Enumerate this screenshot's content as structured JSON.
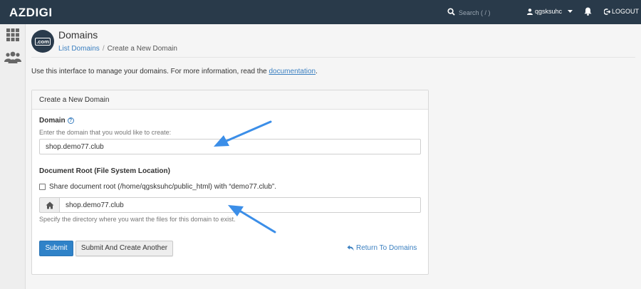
{
  "topbar": {
    "logo": "AZDIGI",
    "search_placeholder": "Search ( / )",
    "username": "qgsksuhc",
    "logout_label": "LOGOUT"
  },
  "header": {
    "logo_text": ".com",
    "title": "Domains",
    "breadcrumb_link": "List Domains",
    "breadcrumb_current": "Create a New Domain"
  },
  "intro": {
    "text": "Use this interface to manage your domains. For more information, read the ",
    "link": "documentation",
    "suffix": "."
  },
  "form": {
    "panel_title": "Create a New Domain",
    "domain_label": "Domain",
    "domain_hint": "Enter the domain that you would like to create:",
    "domain_value": "shop.demo77.club",
    "docroot_label": "Document Root (File System Location)",
    "share_label": "Share document root (/home/qgsksuhc/public_html) with “demo77.club”.",
    "share_checked": false,
    "docroot_value": "shop.demo77.club",
    "docroot_hint": "Specify the directory where you want the files for this domain to exist.",
    "submit_label": "Submit",
    "submit_another_label": "Submit And Create Another",
    "return_label": "Return To Domains"
  },
  "colors": {
    "topbar": "#293a4a",
    "accent": "#2f82c8",
    "link": "#3a7fc0",
    "annotation_arrow": "#3b8ee8"
  }
}
